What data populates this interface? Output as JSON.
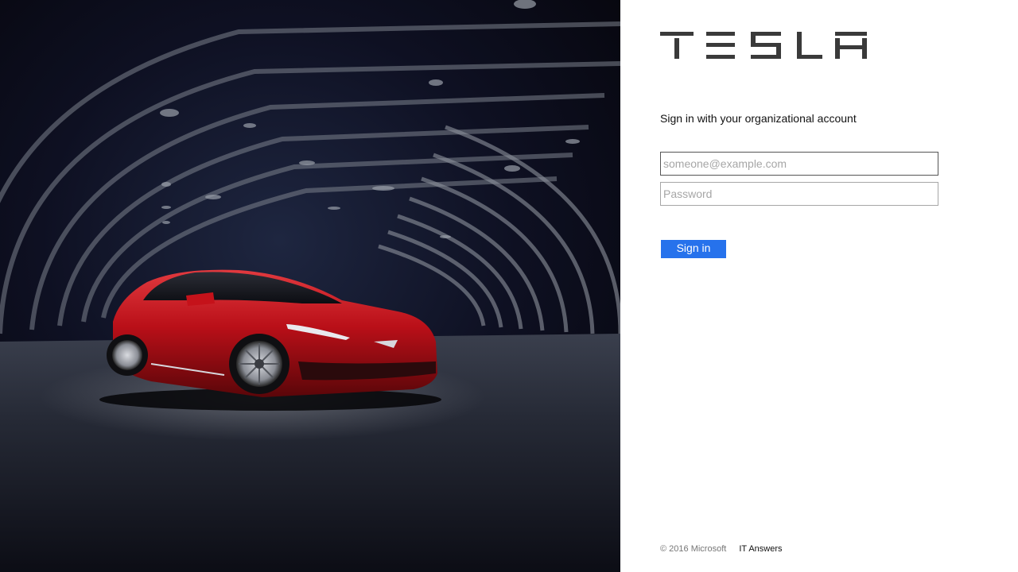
{
  "hero": {
    "image": "red-sedan-in-dark-tunnel",
    "car_color": "#c5121a",
    "background_color": "#0a0b17"
  },
  "logo": {
    "icon": "tesla-wordmark-logo",
    "text": "TESLA",
    "color": "#3a3a3a"
  },
  "signin": {
    "intro": "Sign in with your organizational account",
    "email_placeholder": "someone@example.com",
    "email_value": "",
    "password_placeholder": "Password",
    "password_value": "",
    "button_label": "Sign in",
    "button_color": "#2672ec"
  },
  "footer": {
    "copyright": "© 2016 Microsoft",
    "link_label": "IT Answers"
  }
}
